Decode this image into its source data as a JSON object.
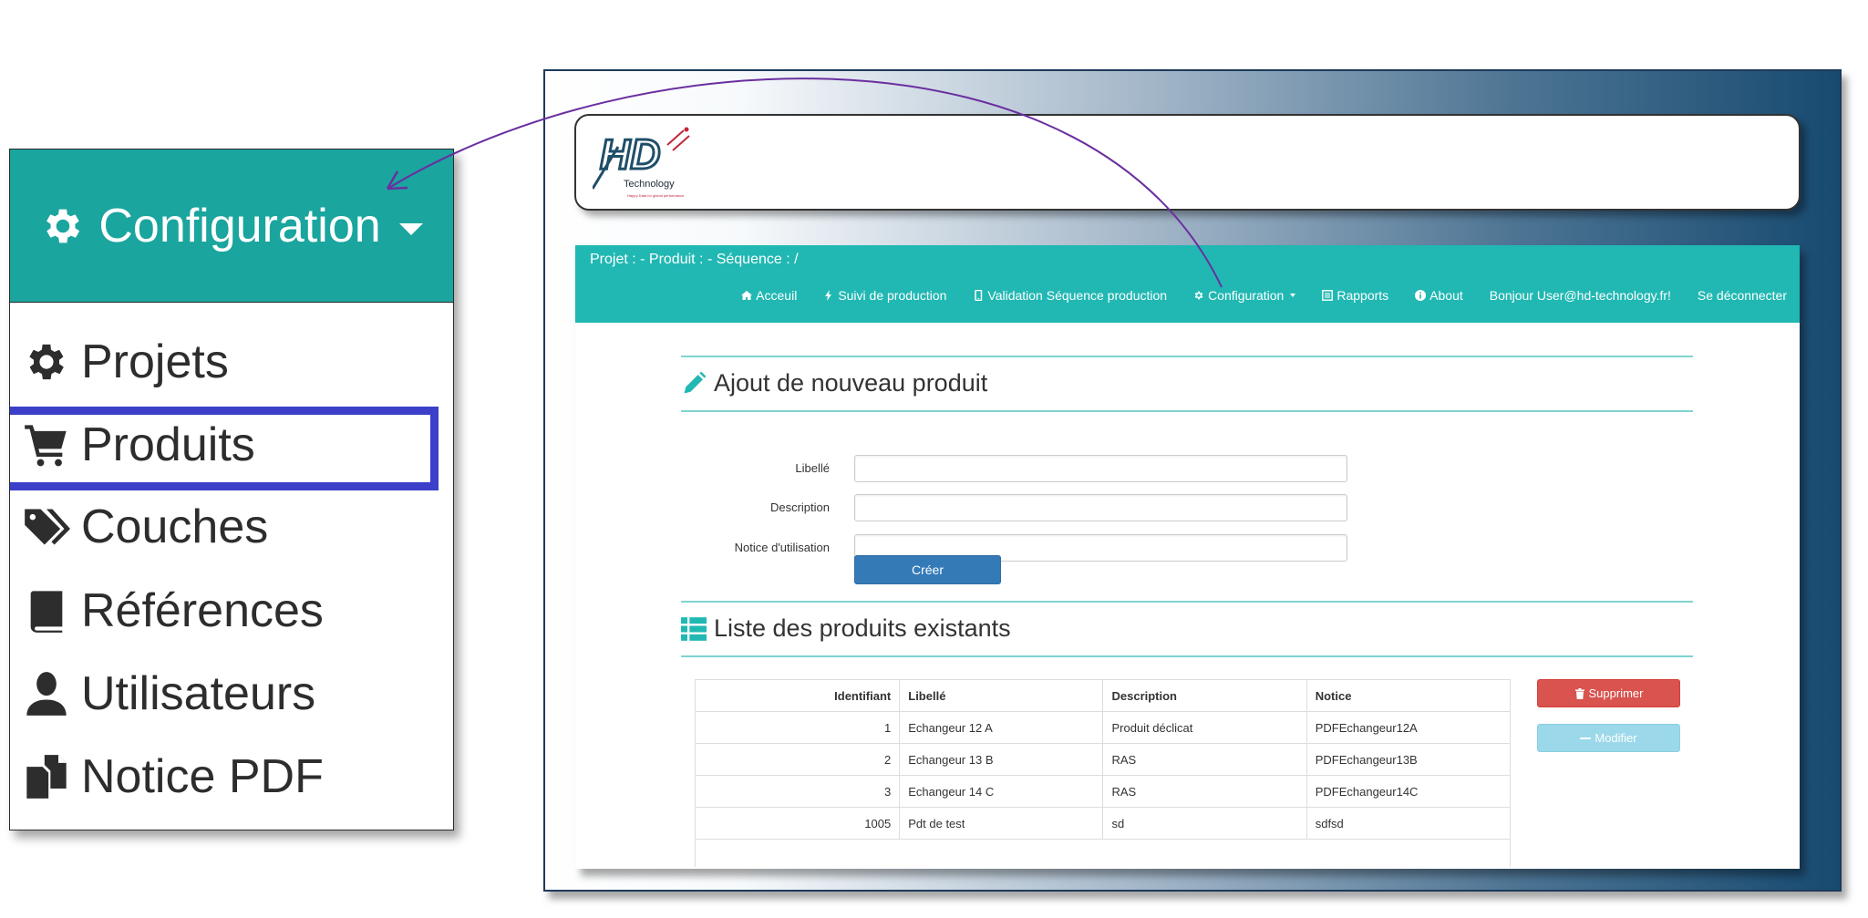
{
  "zoom_menu": {
    "header_label": "Configuration",
    "items": [
      {
        "label": "Projets",
        "icon": "gear-icon"
      },
      {
        "label": "Produits",
        "icon": "cart-icon"
      },
      {
        "label": "Couches",
        "icon": "tags-icon"
      },
      {
        "label": "Références",
        "icon": "book-icon"
      },
      {
        "label": "Utilisateurs",
        "icon": "user-icon"
      },
      {
        "label": "Notice PDF",
        "icon": "files-icon"
      }
    ],
    "highlighted_item": "Produits",
    "highlight_color": "#3b3fc9",
    "header_color": "#1aa59e"
  },
  "logo": {
    "brand": "HD",
    "name": "Technology",
    "tagline": "Happy Data for global performance"
  },
  "navbar": {
    "breadcrumb": "Projet : - Produit : - Séquence : /",
    "color": "#21b8b3",
    "items": [
      {
        "label": "Acceuil",
        "icon": "home-icon"
      },
      {
        "label": "Suivi de production",
        "icon": "bolt-icon"
      },
      {
        "label": "Validation Séquence production",
        "icon": "mobile-icon"
      },
      {
        "label": "Configuration",
        "icon": "gear-icon"
      },
      {
        "label": "Rapports",
        "icon": "list-alt-icon"
      },
      {
        "label": "About",
        "icon": "info-icon"
      },
      {
        "label": "Bonjour User@hd-technology.fr!",
        "icon": ""
      },
      {
        "label": "Se déconnecter",
        "icon": ""
      }
    ]
  },
  "add_form": {
    "title": "Ajout de nouveau produit",
    "fields": [
      {
        "label": "Libellé",
        "value": ""
      },
      {
        "label": "Description",
        "value": ""
      },
      {
        "label": "Notice d'utilisation",
        "value": ""
      }
    ],
    "submit_label": "Créer"
  },
  "product_list": {
    "title": "Liste des produits existants",
    "columns": [
      "Identifiant",
      "Libellé",
      "Description",
      "Notice"
    ],
    "rows": [
      {
        "id": "1",
        "libelle": "Echangeur 12 A",
        "description": "Produit déclicat",
        "notice": "PDFEchangeur12A"
      },
      {
        "id": "2",
        "libelle": "Echangeur 13 B",
        "description": "RAS",
        "notice": "PDFEchangeur13B"
      },
      {
        "id": "3",
        "libelle": "Echangeur 14 C",
        "description": "RAS",
        "notice": "PDFEchangeur14C"
      },
      {
        "id": "1005",
        "libelle": "Pdt de test",
        "description": "sd",
        "notice": "sdfsd"
      }
    ],
    "delete_label": "Supprimer",
    "modify_label": "Modifier",
    "delete_color": "#d9534f",
    "modify_color": "#9bd8ea"
  }
}
